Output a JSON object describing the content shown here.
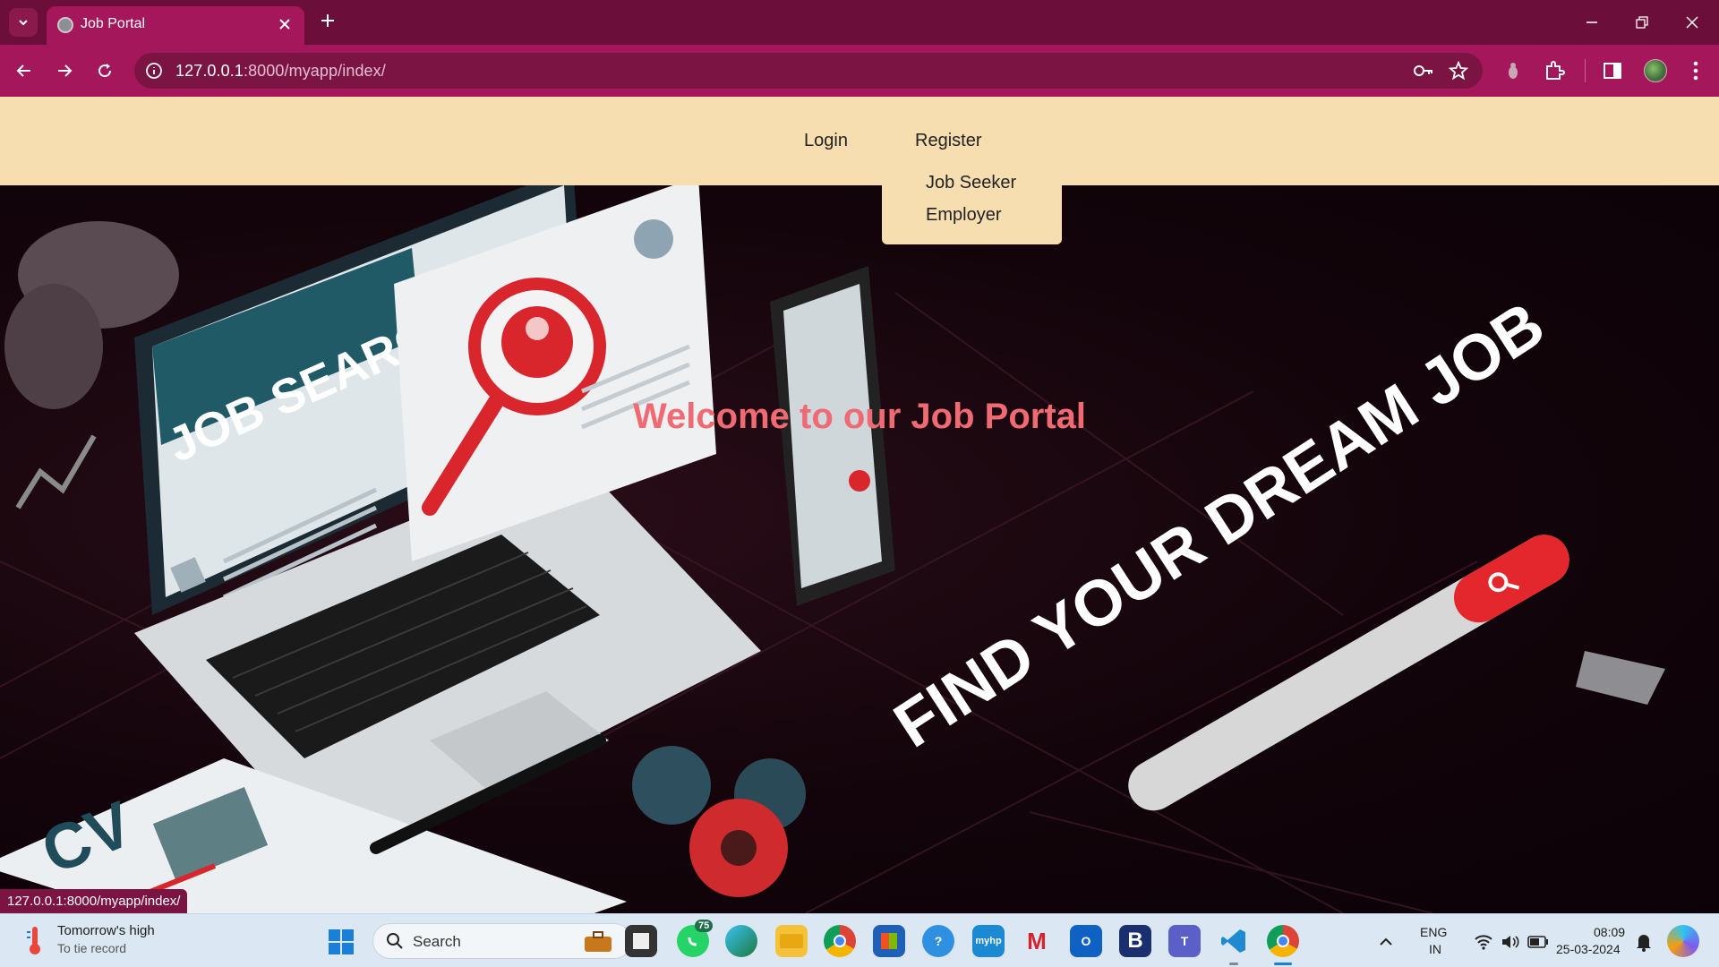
{
  "browser": {
    "tab_title": "Job Portal",
    "url_host": "127.0.0.1",
    "url_rest": ":8000/myapp/index/",
    "status_url": "127.0.0.1:8000/myapp/index/",
    "icons": [
      "tab-search-icon",
      "favicon-globe-icon",
      "close-icon",
      "new-tab-icon",
      "minimize-icon",
      "restore-icon",
      "window-close-icon",
      "back-icon",
      "forward-icon",
      "reload-icon",
      "site-info-icon",
      "password-key-icon",
      "bookmark-star-icon",
      "extension-icon",
      "extensions-puzzle-icon",
      "side-panel-icon",
      "avatar",
      "menu-kebab-icon"
    ]
  },
  "site": {
    "nav": {
      "login": "Login",
      "register": "Register"
    },
    "register_menu": [
      "Job Seeker",
      "Employer"
    ],
    "welcome": "Welcome to our Job Portal",
    "hero_texts": {
      "job_search": "JOB SEARCH",
      "dream_job": "FIND YOUR DREAM JOB",
      "cv": "CV"
    },
    "colors": {
      "nav_bg": "#f6deb1",
      "welcome": "#f06a73",
      "chrome": "#a5175b",
      "tabbar": "#6b0f3a"
    }
  },
  "taskbar": {
    "weather_title": "Tomorrow's high",
    "weather_sub": "To tie record",
    "search_label": "Search",
    "whatsapp_badge": "75",
    "lang_line1": "ENG",
    "lang_line2": "IN",
    "time": "08:09",
    "date": "25-03-2024",
    "app_icons": [
      "start-icon",
      "search-icon",
      "briefcase-icon",
      "file-manager-icon",
      "whatsapp-icon",
      "edge-icon",
      "folder-icon",
      "chrome-icon",
      "store-icon",
      "tips-icon",
      "myhp-icon",
      "mcafee-icon",
      "outlook-icon",
      "b-app-icon",
      "teams-icon",
      "vscode-icon",
      "chrome-profile-icon",
      "chevron-up-icon",
      "wifi-icon",
      "volume-icon",
      "battery-icon",
      "bell-icon",
      "copilot-icon"
    ]
  }
}
